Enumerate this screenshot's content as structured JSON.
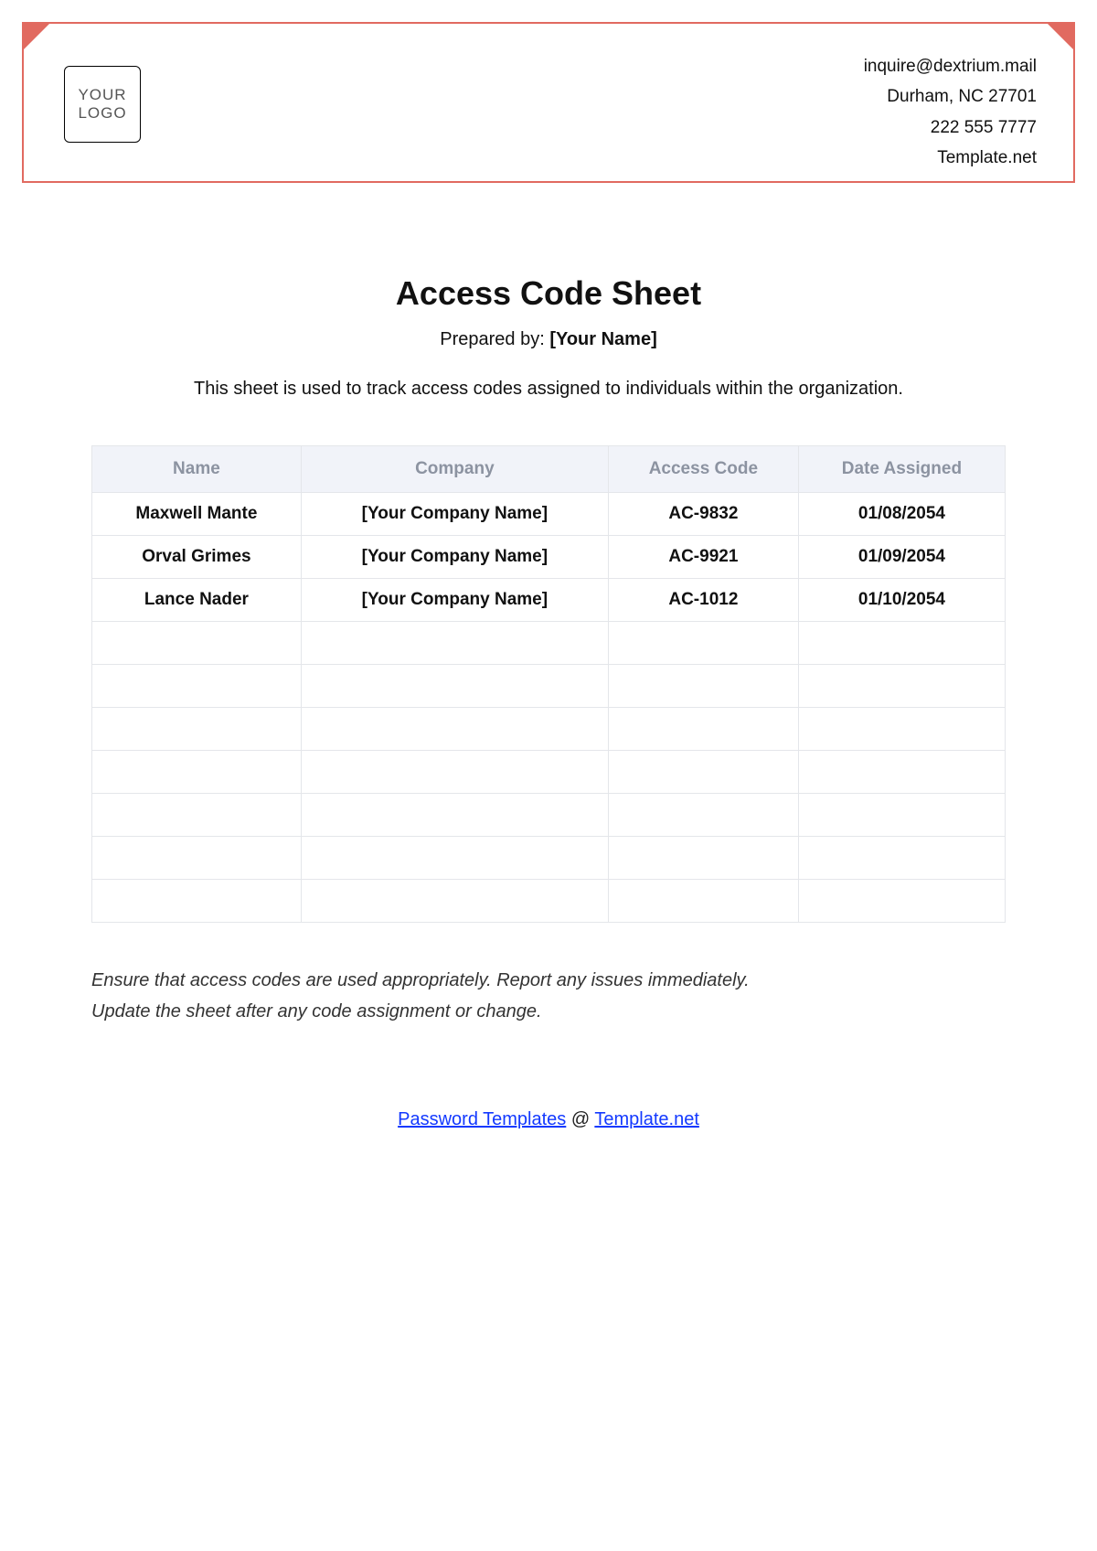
{
  "header": {
    "logo_text": "YOUR LOGO",
    "contact": {
      "email": "inquire@dextrium.mail",
      "address": "Durham, NC 27701",
      "phone": "222 555 7777",
      "site": "Template.net"
    }
  },
  "document": {
    "title": "Access Code Sheet",
    "prepared_label": "Prepared by:",
    "prepared_value": "[Your Name]",
    "description": "This sheet is used to track access codes assigned to individuals within the organization."
  },
  "table": {
    "headers": {
      "name": "Name",
      "company": "Company",
      "code": "Access Code",
      "date": "Date Assigned"
    },
    "rows": [
      {
        "name": "Maxwell Mante",
        "company": "[Your Company Name]",
        "code": "AC-9832",
        "date": "01/08/2054"
      },
      {
        "name": "Orval Grimes",
        "company": "[Your Company Name]",
        "code": "AC-9921",
        "date": "01/09/2054"
      },
      {
        "name": "Lance Nader",
        "company": "[Your Company Name]",
        "code": "AC-1012",
        "date": "01/10/2054"
      },
      {
        "name": "",
        "company": "",
        "code": "",
        "date": ""
      },
      {
        "name": "",
        "company": "",
        "code": "",
        "date": ""
      },
      {
        "name": "",
        "company": "",
        "code": "",
        "date": ""
      },
      {
        "name": "",
        "company": "",
        "code": "",
        "date": ""
      },
      {
        "name": "",
        "company": "",
        "code": "",
        "date": ""
      },
      {
        "name": "",
        "company": "",
        "code": "",
        "date": ""
      },
      {
        "name": "",
        "company": "",
        "code": "",
        "date": ""
      }
    ]
  },
  "notes": {
    "line1": "Ensure that access codes are used appropriately. Report any issues immediately.",
    "line2": "Update the sheet after any code assignment or change."
  },
  "footer": {
    "link1_text": "Password Templates",
    "separator": " @ ",
    "link2_text": "Template.net"
  }
}
